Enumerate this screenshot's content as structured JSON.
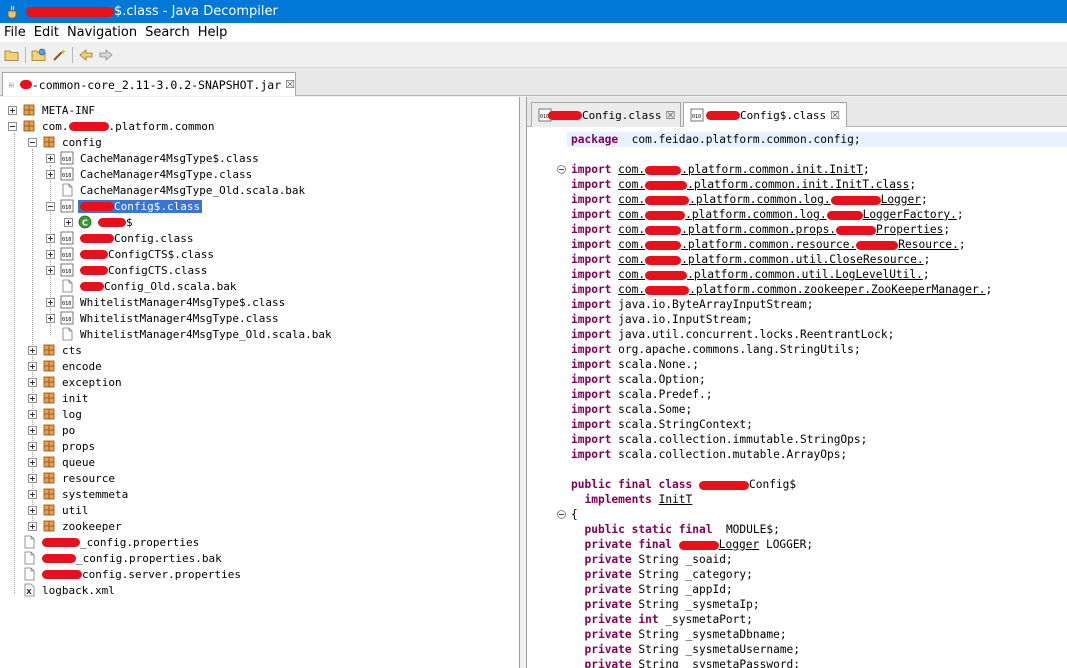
{
  "window": {
    "title_suffix": "$.class - Java Decompiler"
  },
  "menu": [
    "File",
    "Edit",
    "Navigation",
    "Search",
    "Help"
  ],
  "toolbar": {
    "icons": [
      "open-file-icon",
      "open-folder-icon",
      "wand-icon",
      "back-arrow-icon",
      "forward-arrow-icon"
    ]
  },
  "jar_tab": {
    "label": "-common-core_2.11-3.0.2-SNAPSHOT.jar",
    "close": "☒"
  },
  "tree": [
    {
      "label": "META-INF",
      "indent": 0,
      "exp": "plus",
      "icon": "package"
    },
    {
      "label": "com.",
      "label2": ".platform.common",
      "indent": 0,
      "exp": "minus",
      "icon": "package"
    },
    {
      "label": "config",
      "indent": 1,
      "exp": "minus",
      "icon": "package"
    },
    {
      "label": "CacheManager4MsgType$.class",
      "indent": 2,
      "exp": "plus",
      "icon": "class"
    },
    {
      "label": "CacheManager4MsgType.class",
      "indent": 2,
      "exp": "plus",
      "icon": "class"
    },
    {
      "label": "CacheManager4MsgType_Old.scala.bak",
      "indent": 2,
      "exp": "none",
      "icon": "file"
    },
    {
      "label": "Config$.class",
      "indent": 2,
      "exp": "minus",
      "icon": "class",
      "selected": true,
      "redact": true
    },
    {
      "label": "$",
      "indent": 3,
      "exp": "plus",
      "icon": "class-obj",
      "redact": true
    },
    {
      "label": "Config.class",
      "indent": 2,
      "exp": "plus",
      "icon": "class",
      "redact": true
    },
    {
      "label": "ConfigCTS$.class",
      "indent": 2,
      "exp": "plus",
      "icon": "class",
      "redact": true
    },
    {
      "label": "ConfigCTS.class",
      "indent": 2,
      "exp": "plus",
      "icon": "class",
      "redact": true
    },
    {
      "label": "Config_Old.scala.bak",
      "indent": 2,
      "exp": "none",
      "icon": "file",
      "redact": true
    },
    {
      "label": "WhitelistManager4MsgType$.class",
      "indent": 2,
      "exp": "plus",
      "icon": "class"
    },
    {
      "label": "WhitelistManager4MsgType.class",
      "indent": 2,
      "exp": "plus",
      "icon": "class"
    },
    {
      "label": "WhitelistManager4MsgType_Old.scala.bak",
      "indent": 2,
      "exp": "none",
      "icon": "file"
    },
    {
      "label": "cts",
      "indent": 1,
      "exp": "plus",
      "icon": "package"
    },
    {
      "label": "encode",
      "indent": 1,
      "exp": "plus",
      "icon": "package"
    },
    {
      "label": "exception",
      "indent": 1,
      "exp": "plus",
      "icon": "package"
    },
    {
      "label": "init",
      "indent": 1,
      "exp": "plus",
      "icon": "package"
    },
    {
      "label": "log",
      "indent": 1,
      "exp": "plus",
      "icon": "package"
    },
    {
      "label": "po",
      "indent": 1,
      "exp": "plus",
      "icon": "package"
    },
    {
      "label": "props",
      "indent": 1,
      "exp": "plus",
      "icon": "package"
    },
    {
      "label": "queue",
      "indent": 1,
      "exp": "plus",
      "icon": "package"
    },
    {
      "label": "resource",
      "indent": 1,
      "exp": "plus",
      "icon": "package"
    },
    {
      "label": "systemmeta",
      "indent": 1,
      "exp": "plus",
      "icon": "package"
    },
    {
      "label": "util",
      "indent": 1,
      "exp": "plus",
      "icon": "package"
    },
    {
      "label": "zookeeper",
      "indent": 1,
      "exp": "plus",
      "icon": "package"
    },
    {
      "label": "_config.properties",
      "indent": 0,
      "exp": "none",
      "icon": "file",
      "redact": true
    },
    {
      "label": "_config.properties.bak",
      "indent": 0,
      "exp": "none",
      "icon": "file",
      "redact": true
    },
    {
      "label": "config.server.properties",
      "indent": 0,
      "exp": "none",
      "icon": "file",
      "redact": true
    },
    {
      "label": "logback.xml",
      "indent": 0,
      "exp": "none",
      "icon": "xml"
    }
  ],
  "code_tabs": [
    {
      "label": "Config.class",
      "close": "☒"
    },
    {
      "label": "Config$.class",
      "close": "☒"
    }
  ],
  "code": [
    [
      [
        "kw",
        "package"
      ],
      [
        "",
        "  com.feidao.platform.common.config;"
      ]
    ],
    [],
    [
      [
        "kw",
        "import"
      ],
      [
        "",
        " "
      ],
      [
        "ref",
        "com."
      ],
      [
        "r",
        ""
      ],
      [
        "ref",
        ".platform.common.init.InitT"
      ],
      [
        "",
        ";"
      ]
    ],
    [
      [
        "kw",
        "import"
      ],
      [
        "",
        " "
      ],
      [
        "ref",
        "com."
      ],
      [
        "r",
        ""
      ],
      [
        "ref",
        ".platform.common.init.InitT.class"
      ],
      [
        "",
        ";"
      ]
    ],
    [
      [
        "kw",
        "import"
      ],
      [
        "",
        " "
      ],
      [
        "ref",
        "com."
      ],
      [
        "r",
        ""
      ],
      [
        "ref",
        ".platform.common.log."
      ],
      [
        "r",
        ""
      ],
      [
        "ref",
        "Logger"
      ],
      [
        "",
        ";"
      ]
    ],
    [
      [
        "kw",
        "import"
      ],
      [
        "",
        " "
      ],
      [
        "ref",
        "com."
      ],
      [
        "r",
        ""
      ],
      [
        "ref",
        ".platform.common.log."
      ],
      [
        "r",
        ""
      ],
      [
        "ref",
        "LoggerFactory."
      ],
      [
        "",
        ";"
      ]
    ],
    [
      [
        "kw",
        "import"
      ],
      [
        "",
        " "
      ],
      [
        "ref",
        "com."
      ],
      [
        "r",
        ""
      ],
      [
        "ref",
        ".platform.common.props."
      ],
      [
        "r",
        ""
      ],
      [
        "ref",
        "Properties"
      ],
      [
        "",
        ";"
      ]
    ],
    [
      [
        "kw",
        "import"
      ],
      [
        "",
        " "
      ],
      [
        "ref",
        "com."
      ],
      [
        "r",
        ""
      ],
      [
        "ref",
        ".platform.common.resource."
      ],
      [
        "r",
        ""
      ],
      [
        "ref",
        "Resource."
      ],
      [
        "",
        ";"
      ]
    ],
    [
      [
        "kw",
        "import"
      ],
      [
        "",
        " "
      ],
      [
        "ref",
        "com."
      ],
      [
        "r",
        ""
      ],
      [
        "ref",
        ".platform.common.util.CloseResource."
      ],
      [
        "",
        ";"
      ]
    ],
    [
      [
        "kw",
        "import"
      ],
      [
        "",
        " "
      ],
      [
        "ref",
        "com."
      ],
      [
        "r",
        ""
      ],
      [
        "ref",
        ".platform.common.util.LogLevelUtil."
      ],
      [
        "",
        ";"
      ]
    ],
    [
      [
        "kw",
        "import"
      ],
      [
        "",
        " "
      ],
      [
        "ref",
        "com."
      ],
      [
        "r",
        ""
      ],
      [
        "ref",
        ".platform.common.zookeeper.ZooKeeperManager."
      ],
      [
        "",
        ";"
      ]
    ],
    [
      [
        "kw",
        "import"
      ],
      [
        "",
        " java.io.ByteArrayInputStream;"
      ]
    ],
    [
      [
        "kw",
        "import"
      ],
      [
        "",
        " java.io.InputStream;"
      ]
    ],
    [
      [
        "kw",
        "import"
      ],
      [
        "",
        " java.util.concurrent.locks.ReentrantLock;"
      ]
    ],
    [
      [
        "kw",
        "import"
      ],
      [
        "",
        " org.apache.commons.lang.StringUtils;"
      ]
    ],
    [
      [
        "kw",
        "import"
      ],
      [
        "",
        " scala.None.;"
      ]
    ],
    [
      [
        "kw",
        "import"
      ],
      [
        "",
        " scala.Option;"
      ]
    ],
    [
      [
        "kw",
        "import"
      ],
      [
        "",
        " scala.Predef.;"
      ]
    ],
    [
      [
        "kw",
        "import"
      ],
      [
        "",
        " scala.Some;"
      ]
    ],
    [
      [
        "kw",
        "import"
      ],
      [
        "",
        " scala.StringContext;"
      ]
    ],
    [
      [
        "kw",
        "import"
      ],
      [
        "",
        " scala.collection.immutable.StringOps;"
      ]
    ],
    [
      [
        "kw",
        "import"
      ],
      [
        "",
        " scala.collection.mutable.ArrayOps;"
      ]
    ],
    [],
    [
      [
        "kw",
        "public final class"
      ],
      [
        "",
        " "
      ],
      [
        "r",
        ""
      ],
      [
        "",
        "Config$"
      ]
    ],
    [
      [
        "",
        "  "
      ],
      [
        "kw",
        "implements"
      ],
      [
        "",
        " "
      ],
      [
        "ref",
        "InitT"
      ]
    ],
    [
      [
        "",
        "{"
      ]
    ],
    [
      [
        "",
        "  "
      ],
      [
        "kw",
        "public static final"
      ],
      [
        "",
        "  MODULE$;"
      ]
    ],
    [
      [
        "",
        "  "
      ],
      [
        "kw",
        "private final"
      ],
      [
        "",
        " "
      ],
      [
        "r",
        ""
      ],
      [
        "ref",
        "Logger"
      ],
      [
        "",
        " LOGGER;"
      ]
    ],
    [
      [
        "",
        "  "
      ],
      [
        "kw",
        "private"
      ],
      [
        "",
        " String _soaid;"
      ]
    ],
    [
      [
        "",
        "  "
      ],
      [
        "kw",
        "private"
      ],
      [
        "",
        " String _category;"
      ]
    ],
    [
      [
        "",
        "  "
      ],
      [
        "kw",
        "private"
      ],
      [
        "",
        " String _appId;"
      ]
    ],
    [
      [
        "",
        "  "
      ],
      [
        "kw",
        "private"
      ],
      [
        "",
        " String _sysmetaIp;"
      ]
    ],
    [
      [
        "",
        "  "
      ],
      [
        "kw",
        "private int"
      ],
      [
        "",
        " _sysmetaPort;"
      ]
    ],
    [
      [
        "",
        "  "
      ],
      [
        "kw",
        "private"
      ],
      [
        "",
        " String _sysmetaDbname;"
      ]
    ],
    [
      [
        "",
        "  "
      ],
      [
        "kw",
        "private"
      ],
      [
        "",
        " String _sysmetaUsername;"
      ]
    ],
    [
      [
        "",
        "  "
      ],
      [
        "kw",
        "private"
      ],
      [
        "",
        " String _sysmetaPassword;"
      ]
    ]
  ],
  "colors": {
    "titlebar": "#0078d7",
    "keyword": "#7f0055",
    "selection": "#3875d7",
    "redaction": "#e8101a"
  }
}
